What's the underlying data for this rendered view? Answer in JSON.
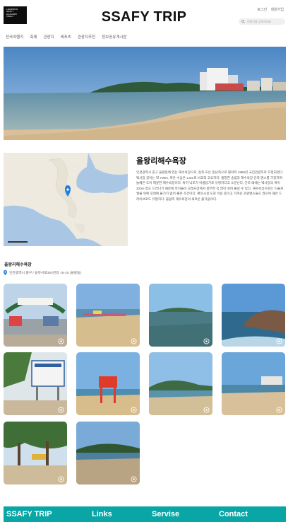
{
  "header": {
    "logo_lines": [
      "LEARNING",
      "SSAFY",
      "ACADEMY",
      "VIDEO"
    ],
    "title": "SSAFY TRIP",
    "login": "로그인",
    "signup": "회원가입",
    "search_placeholder": "여행지를 검색하세요"
  },
  "nav": [
    "전국여행지",
    "축제",
    "관광지",
    "레포츠",
    "관광지추천",
    "정보공유게시판"
  ],
  "beach": {
    "title": "을왕리해수욕장",
    "description": "인천광역시 중구 을왕동에 있는 해수욕장으로, 동쪽 또는 동남쪽으로 펼쳐져 1986년 국민관광지로 지정되었다. 백사장 길이는 약 700m, 폭은 수심은 1.5m로 비교적 고요하다. 울창한 송림과 해수욕장 안쪽 명소를 가장하여 놀예은 도어 깨끗한 해수욕장이다. 특히 낙조가 아름답기로 유명하다고 소문난다. 간조 때에는 백사장의 폭이 200m 정도 드러나기 때문에 아이들이 모래사장에서 풍부한 즉 많이 쉬며 즐길 수 있다. 해수욕장으로는 드물게 썰물 뒤에 모래에 물기가 없어 좋은 조건이다. 편의시설 도로 이용 중이고 가까운 관광명소들도 많으며 해안 드라이브로도 유명하다. 을왕리 해수욕장의 새로운 즐거움이다.",
    "subtitle": "을왕리해수욕장",
    "address": "인천광역시 중구 / 용유서로302번길 16-15 (을왕동)"
  },
  "footer": {
    "brand": "SSAFY TRIP",
    "links": "Links",
    "service": "Servise",
    "contact": "Contact"
  },
  "colors": {
    "accent": "#0aa6a6",
    "text": "#222222",
    "muted": "#666666"
  }
}
